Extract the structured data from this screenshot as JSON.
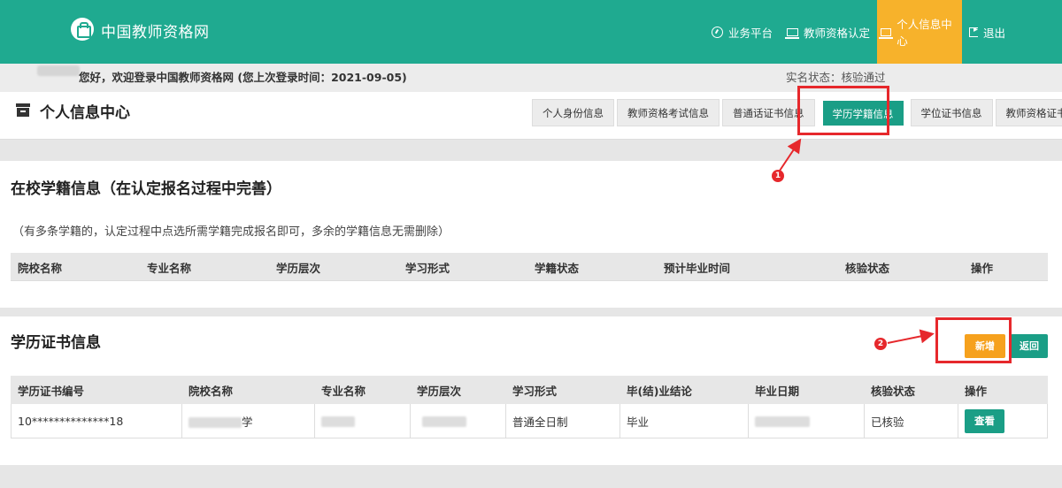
{
  "header": {
    "site_title": "中国教师资格网",
    "nav": [
      {
        "label": "业务平台",
        "icon": "dashboard-icon"
      },
      {
        "label": "教师资格认定",
        "icon": "monitor-icon"
      },
      {
        "label": "个人信息中心",
        "icon": "monitor-icon",
        "active": true
      },
      {
        "label": "退出",
        "icon": "logout-icon"
      }
    ],
    "colors": {
      "primary": "#1faa90",
      "active_nav": "#f7b22b"
    }
  },
  "welcome": {
    "text": "您好，欢迎登录中国教师资格网 (您上次登录时间：2021-09-05)",
    "realname_status": "实名状态：核验通过"
  },
  "page": {
    "title": "个人信息中心",
    "tabs": [
      "个人身份信息",
      "教师资格考试信息",
      "普通话证书信息",
      "学历学籍信息",
      "学位证书信息",
      "教师资格证书信息"
    ],
    "active_tab_index": 3
  },
  "annotations": {
    "marker1": "1",
    "marker2": "2",
    "color": "#e6282c"
  },
  "enrollment_section": {
    "title": "在校学籍信息（在认定报名过程中完善）",
    "note": "（有多条学籍的，认定过程中点选所需学籍完成报名即可，多余的学籍信息无需删除）",
    "columns": [
      "院校名称",
      "专业名称",
      "学历层次",
      "学习形式",
      "学籍状态",
      "预计毕业时间",
      "核验状态",
      "操作"
    ]
  },
  "certificate_section": {
    "title": "学历证书信息",
    "add_button": "新增",
    "back_button": "返回",
    "columns": [
      "学历证书编号",
      "院校名称",
      "专业名称",
      "学历层次",
      "学习形式",
      "毕(结)业结论",
      "毕业日期",
      "核验状态",
      "操作"
    ],
    "rows": [
      {
        "cert_no": "10**************18",
        "school_suffix": "学",
        "study_form": "普通全日制",
        "conclusion": "毕业",
        "verify_status": "已核验",
        "action": "查看"
      }
    ]
  }
}
